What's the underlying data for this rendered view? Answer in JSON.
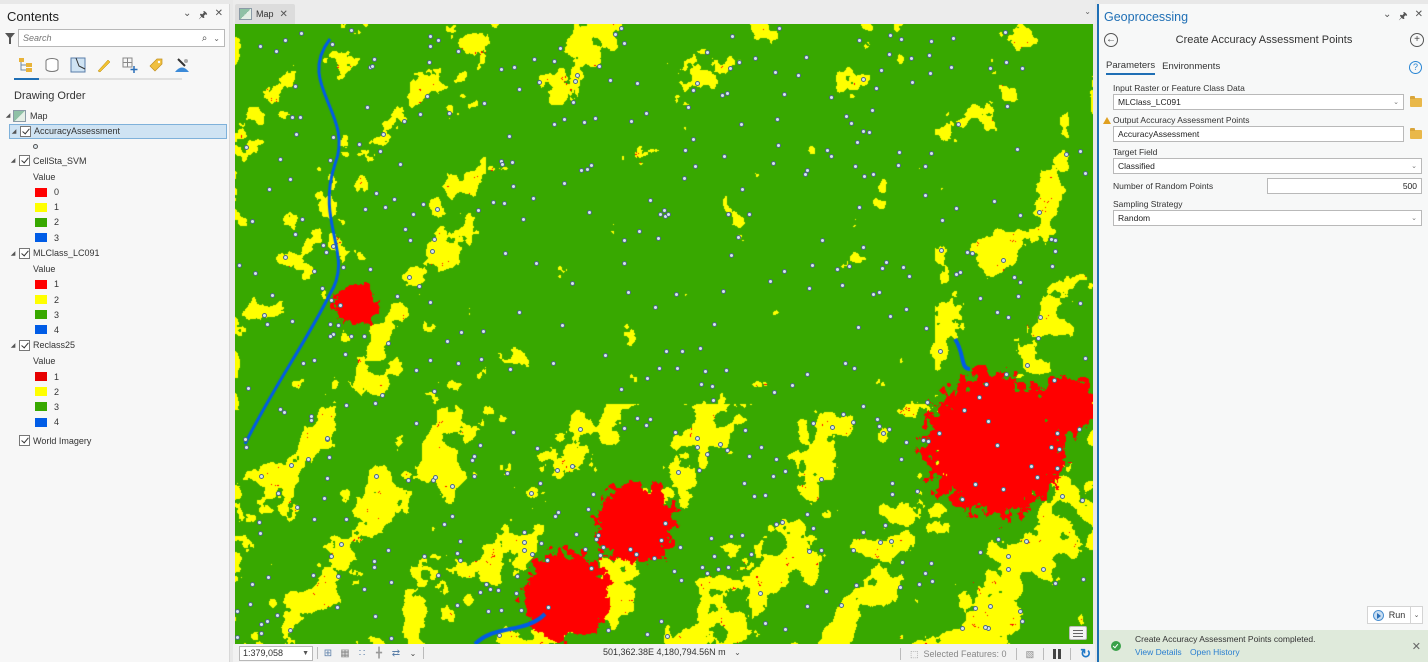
{
  "contents": {
    "title": "Contents",
    "search_placeholder": "Search",
    "section_title": "Drawing Order",
    "map_name": "Map",
    "layers": [
      {
        "name": "AccuracyAssessment",
        "checked": true,
        "selected": true
      },
      {
        "name": "CellSta_SVM",
        "checked": true,
        "legend_heading": "Value",
        "classes": [
          {
            "label": "0",
            "color": "#ff0000"
          },
          {
            "label": "1",
            "color": "#ffff00"
          },
          {
            "label": "2",
            "color": "#38a800"
          },
          {
            "label": "3",
            "color": "#005ce6"
          }
        ]
      },
      {
        "name": "MLClass_LC091",
        "checked": true,
        "legend_heading": "Value",
        "classes": [
          {
            "label": "1",
            "color": "#ff0000"
          },
          {
            "label": "2",
            "color": "#ffff00"
          },
          {
            "label": "3",
            "color": "#38a800"
          },
          {
            "label": "4",
            "color": "#005ce6"
          }
        ]
      },
      {
        "name": "Reclass25",
        "checked": true,
        "legend_heading": "Value",
        "classes": [
          {
            "label": "1",
            "color": "#e60000"
          },
          {
            "label": "2",
            "color": "#ffff00"
          },
          {
            "label": "3",
            "color": "#38a800"
          },
          {
            "label": "4",
            "color": "#005ce6"
          }
        ]
      },
      {
        "name": "World Imagery",
        "checked": true
      }
    ]
  },
  "map_view": {
    "tab_label": "Map",
    "scale": "1:379,058",
    "coordinates": "501,362.38E 4,180,794.56N m",
    "selected_features": "Selected Features: 0",
    "class_colors": {
      "urban": "#ff0000",
      "open": "#ffff00",
      "forest": "#38a800",
      "water": "#005ce6"
    }
  },
  "geoprocessing": {
    "pane_title": "Geoprocessing",
    "tool_title": "Create Accuracy Assessment Points",
    "tabs": [
      "Parameters",
      "Environments"
    ],
    "params": {
      "input_label": "Input Raster or Feature Class Data",
      "input_value": "MLClass_LC091",
      "output_label": "Output Accuracy Assessment Points",
      "output_value": "AccuracyAssessment",
      "target_label": "Target Field",
      "target_value": "Classified",
      "num_points_label": "Number of Random Points",
      "num_points_value": "500",
      "strategy_label": "Sampling Strategy",
      "strategy_value": "Random"
    },
    "run_label": "Run",
    "notification": {
      "message": "Create Accuracy Assessment Points completed.",
      "link_details": "View Details",
      "link_history": "Open History"
    }
  }
}
